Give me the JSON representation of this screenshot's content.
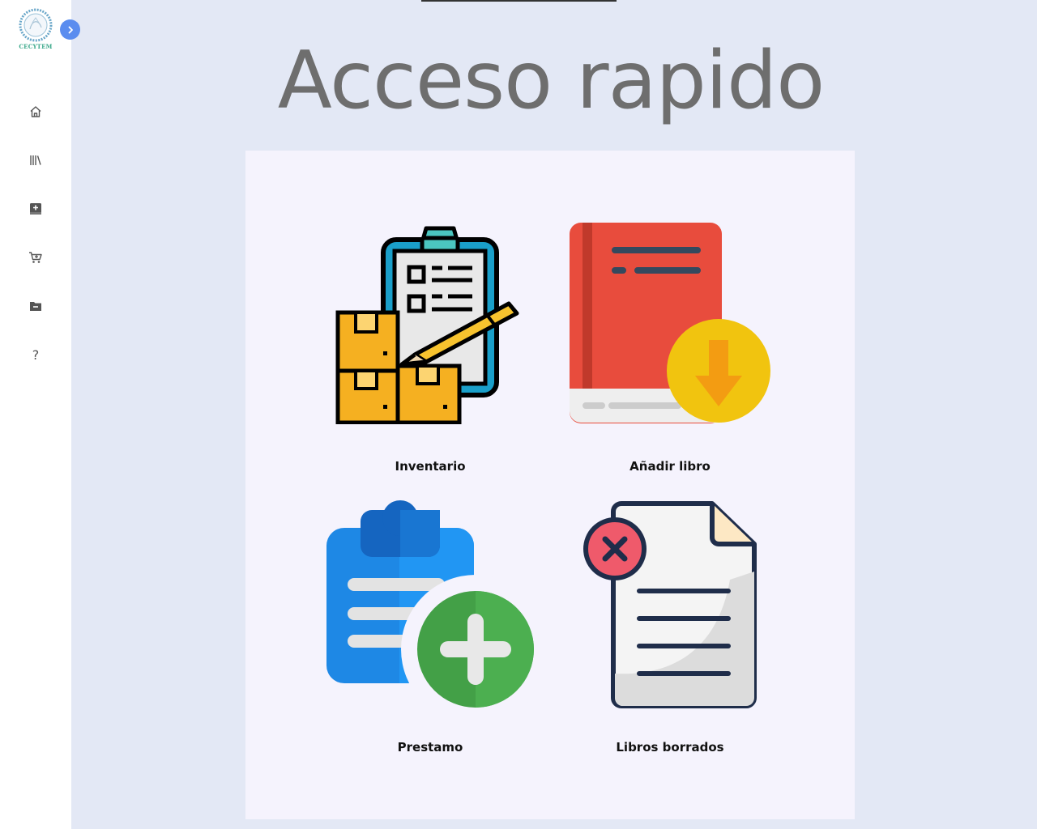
{
  "sidebar": {
    "logo_text": "CECYTEM",
    "items": [
      {
        "name": "home",
        "icon": "home-icon"
      },
      {
        "name": "library",
        "icon": "library-icon"
      },
      {
        "name": "add-book",
        "icon": "add-book-icon"
      },
      {
        "name": "cart",
        "icon": "cart-icon"
      },
      {
        "name": "folder",
        "icon": "folder-minus-icon"
      },
      {
        "name": "help",
        "icon": "help-icon",
        "label": "?"
      }
    ]
  },
  "main": {
    "title": "Acceso rapido",
    "tiles": [
      {
        "label": "Inventario",
        "icon": "inventory-clipboard-icon"
      },
      {
        "label": "Añadir libro",
        "icon": "book-download-icon"
      },
      {
        "label": "Prestamo",
        "icon": "clipboard-plus-icon"
      },
      {
        "label": "Libros borrados",
        "icon": "document-delete-icon"
      }
    ]
  },
  "colors": {
    "background": "#e3e8f5",
    "panel": "#f5f3fd",
    "toggle": "#5b8def",
    "title": "#6e6e6e"
  }
}
